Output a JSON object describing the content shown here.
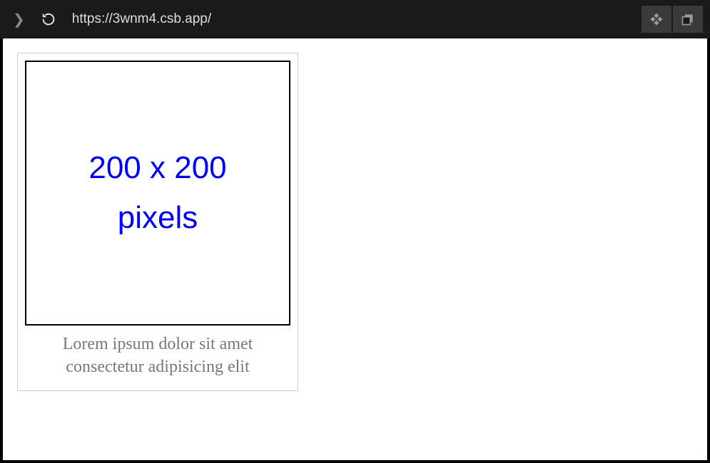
{
  "browser": {
    "url": "https://3wnm4.csb.app/",
    "nav_forward_glyph": "❯"
  },
  "page": {
    "placeholder": {
      "line1": "200 x 200",
      "line2": "pixels"
    },
    "caption": "Lorem ipsum dolor sit amet consectetur adipisicing elit"
  }
}
